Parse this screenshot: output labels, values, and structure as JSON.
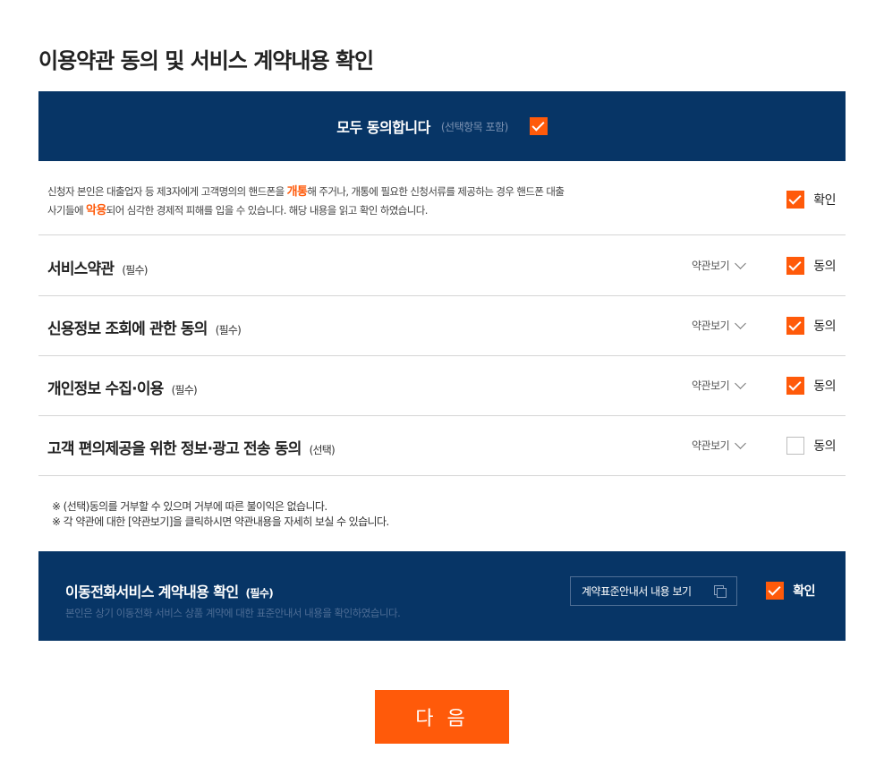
{
  "page_title": "이용약관 동의 및 서비스 계약내용 확인",
  "agree_all": {
    "label": "모두 동의합니다",
    "note": "(선택항목 포함)",
    "checked": true
  },
  "notice": {
    "part1": "신청자 본인은 대출업자 등 제3자에게 고객명의의 핸드폰을 ",
    "highlight1": "개통",
    "part2": "해 주거나, 개통에 필요한 신청서류를 제공하는 경우 핸드폰 대출",
    "part3": "사기들에 ",
    "highlight2": "악용",
    "part4": "되어 심각한 경제적 피해를 입을 수 있습니다. 해당 내용을 읽고 확인 하였습니다.",
    "check_label": "확인",
    "checked": true
  },
  "terms": [
    {
      "title": "서비스약관",
      "tag": "(필수)",
      "view_label": "약관보기",
      "check_label": "동의",
      "checked": true
    },
    {
      "title": "신용정보 조회에 관한 동의",
      "tag": "(필수)",
      "view_label": "약관보기",
      "check_label": "동의",
      "checked": true
    },
    {
      "title": "개인정보 수집·이용",
      "tag": "(필수)",
      "view_label": "약관보기",
      "check_label": "동의",
      "checked": true
    },
    {
      "title": "고객 편의제공을 위한 정보·광고 전송 동의",
      "tag": "(선택)",
      "view_label": "약관보기",
      "check_label": "동의",
      "checked": false
    }
  ],
  "footnotes": [
    "※ (선택)동의를 거부할 수 있으며 거부에 따른 불이익은 없습니다.",
    "※ 각 약관에 대한 [약관보기]을 클릭하시면 약관내용을 자세히 보실 수 있습니다."
  ],
  "mobile_contract": {
    "title": "이동전화서비스 계약내용 확인",
    "tag": "(필수)",
    "description": "본인은 상기 이동전화 서비스 상품 계약에 대한 표준안내서 내용을 확인하였습니다.",
    "button_label": "계약표준안내서 내용 보기",
    "check_label": "확인",
    "checked": true
  },
  "next_button": "다 음",
  "colors": {
    "navy": "#073566",
    "accent": "#ff5a0a"
  }
}
